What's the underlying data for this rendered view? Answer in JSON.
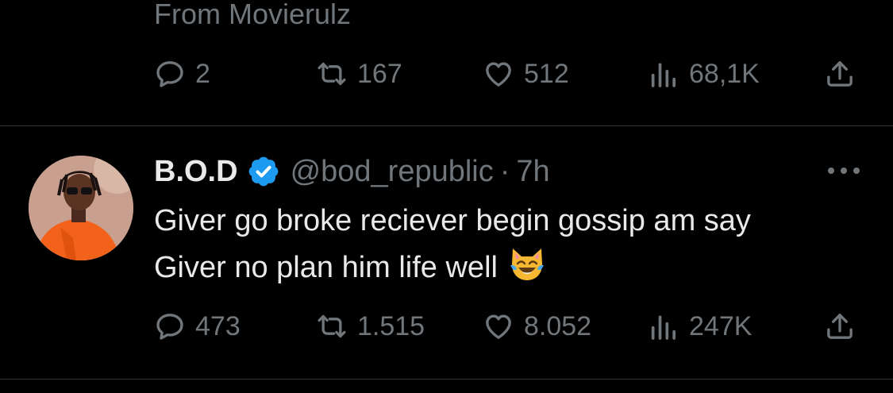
{
  "tweets": [
    {
      "text": "From Movierulz",
      "stats": {
        "replies": "2",
        "retweets": "167",
        "likes": "512",
        "views": "68,1K"
      }
    },
    {
      "author": {
        "display_name": "B.O.D",
        "handle": "@bod_republic",
        "verified": true
      },
      "separator": "·",
      "time": "7h",
      "text_lines": [
        "Giver go broke reciever begin gossip am say",
        "Giver no plan him life well"
      ],
      "emoji": "cat-face-with-tears-of-joy",
      "stats": {
        "replies": "473",
        "retweets": "1.515",
        "likes": "8.052",
        "views": "247K"
      }
    }
  ],
  "icons": {
    "reply": "speech-bubble-icon",
    "retweet": "retweet-icon",
    "like": "heart-icon",
    "views": "views-bar-chart-icon",
    "share": "share-upload-icon",
    "more": "more-dots-icon",
    "verified": "verified-badge-icon"
  },
  "colors": {
    "background": "#000000",
    "text_primary": "#e7e9ea",
    "text_secondary": "#71767b",
    "divider": "#2f3336",
    "verified_blue": "#1d9bf0"
  }
}
